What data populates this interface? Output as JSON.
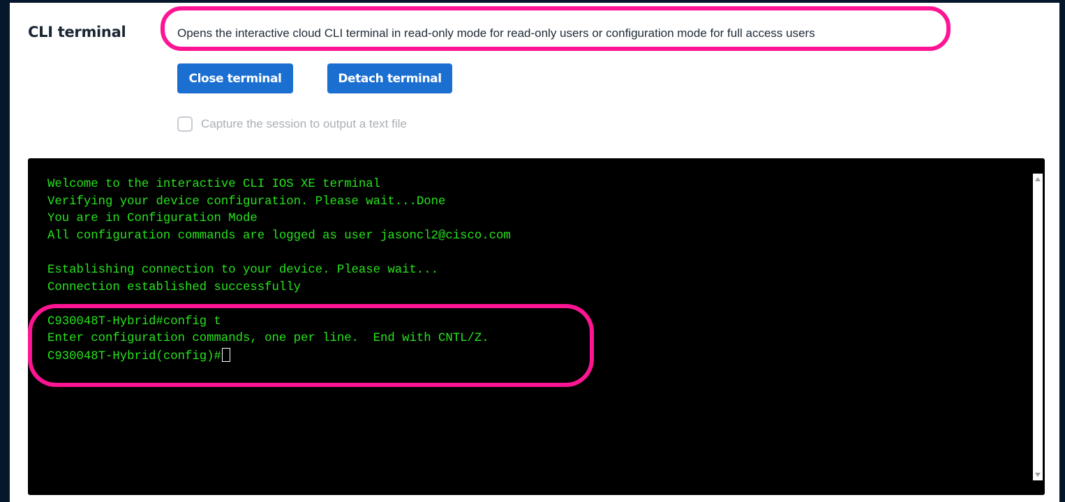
{
  "section": {
    "title": "CLI terminal",
    "description": "Opens the interactive cloud CLI terminal in read-only mode for read-only users or configuration mode for full access users"
  },
  "buttons": {
    "close_label": "Close terminal",
    "detach_label": "Detach terminal"
  },
  "capture": {
    "label": "Capture the session to output a text file",
    "checked": false
  },
  "terminal": {
    "lines": [
      "Welcome to the interactive CLI IOS XE terminal",
      "Verifying your device configuration. Please wait...Done",
      "You are in Configuration Mode",
      "All configuration commands are logged as user jasoncl2@cisco.com",
      "",
      "Establishing connection to your device. Please wait...",
      "Connection established successfully",
      "",
      "C930048T-Hybrid#config t",
      "Enter configuration commands, one per line.  End with CNTL/Z.",
      "C930048T-Hybrid(config)#"
    ]
  },
  "colors": {
    "outer_background": "#05172b",
    "button_blue": "#1b6fd1",
    "terminal_text": "#27e51d",
    "highlight": "#ff1493"
  },
  "icons": {
    "scroll_up": "scroll-up-arrow-icon",
    "scroll_down": "scroll-down-arrow-icon",
    "checkbox": "checkbox-icon"
  }
}
